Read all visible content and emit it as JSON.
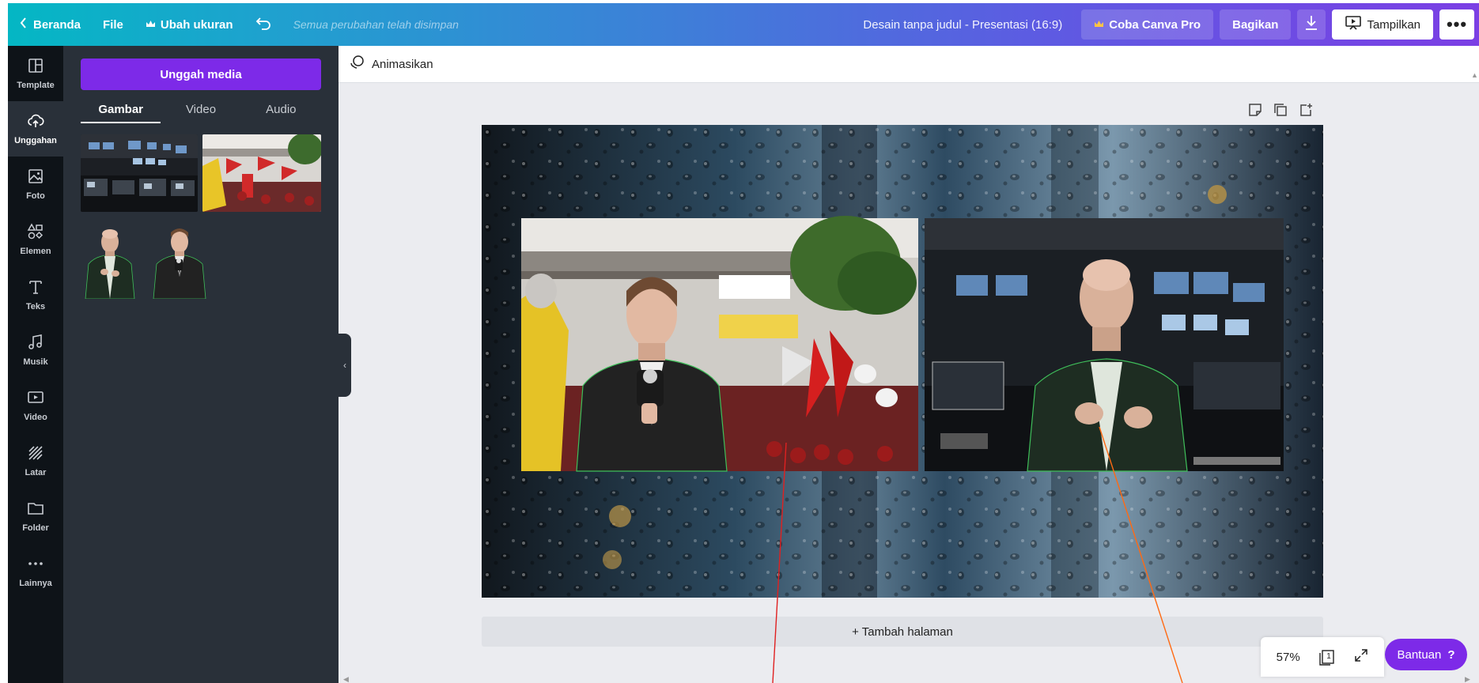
{
  "topbar": {
    "home_label": "Beranda",
    "file_label": "File",
    "resize_label": "Ubah ukuran",
    "saved_text": "Semua perubahan telah disimpan",
    "doc_title": "Desain tanpa judul - Presentasi (16:9)",
    "try_pro_label": "Coba Canva Pro",
    "share_label": "Bagikan",
    "present_label": "Tampilkan",
    "more_label": "•••"
  },
  "rail": {
    "items": [
      {
        "label": "Template",
        "icon": "template-icon"
      },
      {
        "label": "Unggahan",
        "icon": "upload-cloud-icon"
      },
      {
        "label": "Foto",
        "icon": "photo-icon"
      },
      {
        "label": "Elemen",
        "icon": "elements-icon"
      },
      {
        "label": "Teks",
        "icon": "text-icon"
      },
      {
        "label": "Musik",
        "icon": "music-icon"
      },
      {
        "label": "Video",
        "icon": "video-icon"
      },
      {
        "label": "Latar",
        "icon": "background-icon"
      },
      {
        "label": "Folder",
        "icon": "folder-icon"
      },
      {
        "label": "Lainnya",
        "icon": "more-icon"
      }
    ],
    "active_index": 1
  },
  "panel": {
    "upload_label": "Unggah media",
    "tabs": [
      "Gambar",
      "Video",
      "Audio"
    ],
    "active_tab": 0
  },
  "editor": {
    "animate_label": "Animasikan",
    "add_page_label": "+ Tambah halaman",
    "zoom": "57%",
    "page_count": "1",
    "help_label": "Bantuan",
    "help_icon": "?"
  },
  "colors": {
    "purple": "#7d2ae8",
    "panel": "#293039",
    "rail": "#0e1318",
    "canvas_bg": "#ebecf0"
  }
}
